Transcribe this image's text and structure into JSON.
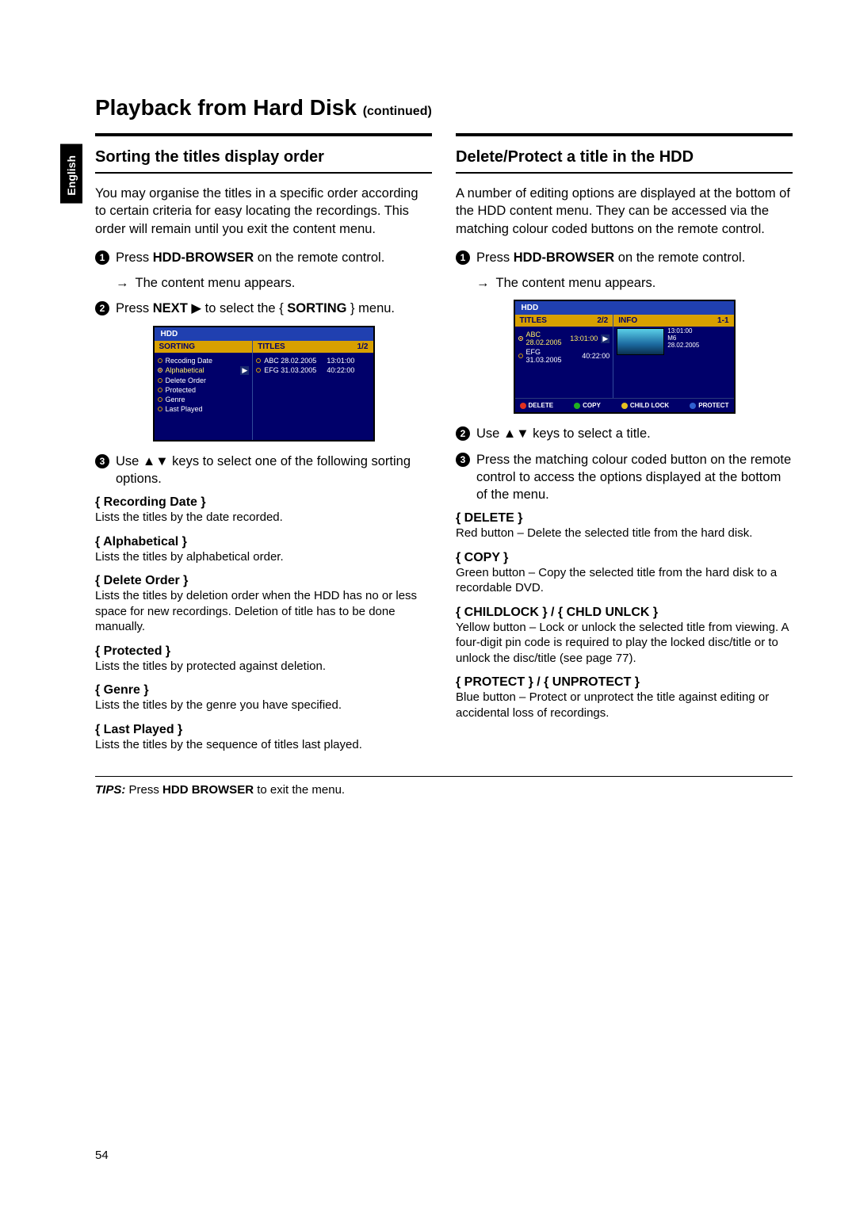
{
  "lang_tab": "English",
  "page_title": "Playback from Hard Disk",
  "page_title_suffix": "(continued)",
  "page_number": "54",
  "fig1": {
    "header": "HDD",
    "left_head": "SORTING",
    "right_head": "TITLES",
    "right_count": "1/2",
    "sort_options": [
      "Recoding Date",
      "Alphabetical",
      "Delete Order",
      "Protected",
      "Genre",
      "Last Played"
    ],
    "titles": [
      {
        "name": "ABC 28.02.2005",
        "len": "13:01:00"
      },
      {
        "name": "EFG 31.03.2005",
        "len": "40:22:00"
      }
    ]
  },
  "fig2": {
    "header": "HDD",
    "left_head": "TITLES",
    "left_count": "2/2",
    "right_head": "INFO",
    "right_count": "1-1",
    "titles": [
      {
        "name": "ABC 28.02.2005",
        "len": "13:01:00"
      },
      {
        "name": "EFG 31.03.2005",
        "len": "40:22:00"
      }
    ],
    "info": {
      "len": "13:01:00",
      "label": "M6",
      "date": "28.02.2005"
    },
    "btns": [
      "DELETE",
      "COPY",
      "CHILD LOCK",
      "PROTECT"
    ]
  },
  "left": {
    "heading": "Sorting the titles display order",
    "intro": "You may organise the titles in a specific order according to certain criteria for easy locating the recordings. This order will remain until you exit the content menu.",
    "step1_pre": "Press ",
    "step1_bold": "HDD-BROWSER",
    "step1_post": " on the remote control.",
    "result1": "The content menu appears.",
    "step2_pre": "Press ",
    "step2_bold1": "NEXT",
    "step2_mid": " ▶  to select the { ",
    "step2_bold2": "SORTING",
    "step2_post": " } menu.",
    "step3": "Use ▲▼ keys to select one of the following sorting options.",
    "opts": [
      {
        "h": "{ Recording Date }",
        "d": "Lists the titles by the date recorded."
      },
      {
        "h": "{ Alphabetical }",
        "d": "Lists the titles by alphabetical order."
      },
      {
        "h": "{ Delete Order }",
        "d": "Lists the titles by deletion order when the HDD has no or less space for new recordings. Deletion of title has to be done manually."
      },
      {
        "h": "{ Protected }",
        "d": "Lists the titles by protected against deletion."
      },
      {
        "h": "{ Genre }",
        "d": "Lists the titles by the genre you have specified."
      },
      {
        "h": "{ Last Played }",
        "d": "Lists the titles by the sequence of titles last played."
      }
    ]
  },
  "right": {
    "heading": "Delete/Protect a title in the HDD",
    "intro": "A number of editing options are displayed at the bottom of the HDD content menu. They can be accessed via the matching colour coded buttons on the remote control.",
    "step1_pre": "Press ",
    "step1_bold": "HDD-BROWSER",
    "step1_post": " on the remote control.",
    "result1": "The content menu appears.",
    "step2": "Use ▲▼ keys to select a title.",
    "step3": "Press the matching colour coded button on the remote control to access the options displayed at the bottom of the menu.",
    "opts": [
      {
        "h": "{ DELETE }",
        "d": "Red button – Delete the selected title from the hard disk."
      },
      {
        "h": "{ COPY }",
        "d": "Green button – Copy the selected title from the hard disk to a recordable DVD."
      },
      {
        "h": "{ CHILDLOCK } / { CHLD UNLCK }",
        "d": "Yellow button – Lock or unlock the selected title from viewing.  A four-digit pin code is required to play the locked disc/title or to unlock the disc/title (see page 77)."
      },
      {
        "h": "{ PROTECT } / { UNPROTECT }",
        "d": "Blue button – Protect or unprotect the title against editing or accidental loss of recordings."
      }
    ]
  },
  "tips": {
    "label": "TIPS:",
    "pre": "  Press ",
    "bold": "HDD BROWSER",
    "post": " to exit the menu."
  }
}
